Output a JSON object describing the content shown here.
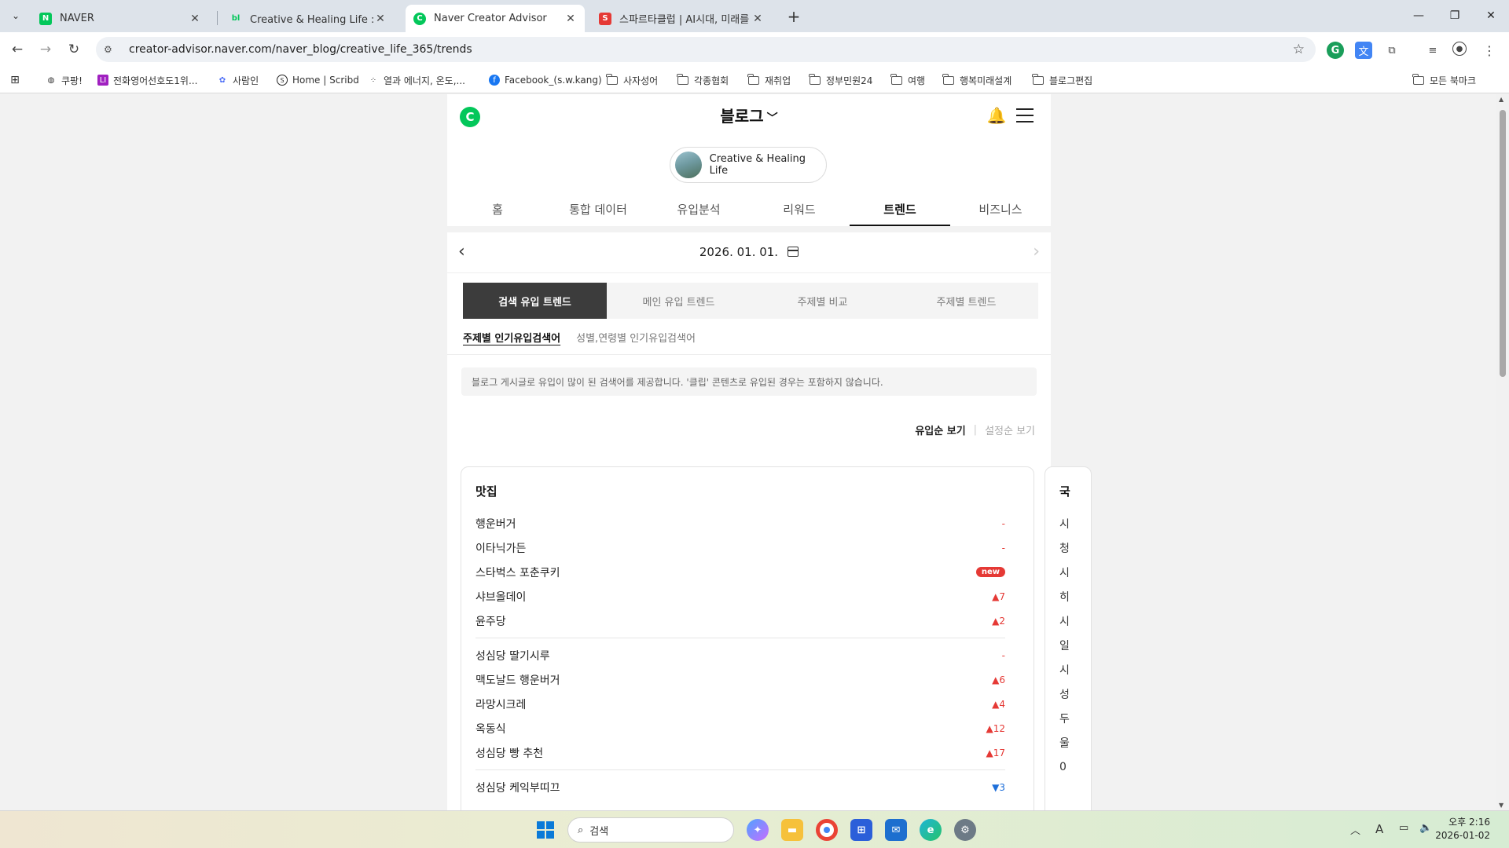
{
  "browser": {
    "tabs": [
      {
        "title": "NAVER",
        "favicon": "N",
        "color": "#03c75a",
        "active": false
      },
      {
        "title": "Creative & Healing Life : 네이버",
        "favicon": "bl",
        "color": "#03c75a",
        "active": false
      },
      {
        "title": "Naver Creator Advisor",
        "favicon": "C",
        "color": "#03c75a",
        "active": true
      },
      {
        "title": "스파르타클럽 | AI시대, 미래를",
        "favicon": "S",
        "color": "#e53935",
        "active": false
      }
    ],
    "url": "creator-advisor.naver.com/naver_blog/creative_life_365/trends",
    "bookmarks": [
      {
        "label": "쿠팡!",
        "type": "site"
      },
      {
        "label": "전화영어선호도1위...",
        "type": "site"
      },
      {
        "label": "사람인",
        "type": "site"
      },
      {
        "label": "Home | Scribd",
        "type": "site"
      },
      {
        "label": "열과 에너지, 온도,...",
        "type": "site"
      },
      {
        "label": "Facebook_(s.w.kang)",
        "type": "site"
      },
      {
        "label": "사자성어",
        "type": "folder"
      },
      {
        "label": "각종협회",
        "type": "folder"
      },
      {
        "label": "재취업",
        "type": "folder"
      },
      {
        "label": "정부민원24",
        "type": "folder"
      },
      {
        "label": "여행",
        "type": "folder"
      },
      {
        "label": "행복미래설계",
        "type": "folder"
      },
      {
        "label": "블로그편집",
        "type": "folder"
      }
    ],
    "all_bookmarks": "모든 북마크"
  },
  "app": {
    "service": "블로그",
    "blog_name": "Creative & Healing Life",
    "main_tabs": [
      "홈",
      "통합 데이터",
      "유입분석",
      "리워드",
      "트렌드",
      "비즈니스"
    ],
    "active_tab": "트렌드",
    "date": "2026. 01. 01.",
    "segments": [
      "검색 유입 트렌드",
      "메인 유입 트렌드",
      "주제별 비교",
      "주제별 트렌드"
    ],
    "subtabs": [
      "주제별 인기유입검색어",
      "성별,연령별 인기유입검색어"
    ],
    "notice": "블로그 게시글로 유입이 많이 된 검색어를 제공합니다. '클립' 콘텐츠로 유입된 경우는 포함하지 않습니다.",
    "sort": {
      "active": "유입순 보기",
      "inactive": "설정순 보기"
    },
    "card": {
      "title": "맛집",
      "groups": [
        [
          {
            "term": "행운버거",
            "change": "-",
            "kind": "none"
          },
          {
            "term": "이타닉가든",
            "change": "-",
            "kind": "none"
          },
          {
            "term": "스타벅스 포춘쿠키",
            "change": "new",
            "kind": "new"
          },
          {
            "term": "샤브올데이",
            "change": "▲7",
            "kind": "up"
          },
          {
            "term": "윤주당",
            "change": "▲2",
            "kind": "up"
          }
        ],
        [
          {
            "term": "성심당 딸기시루",
            "change": "-",
            "kind": "none"
          },
          {
            "term": "맥도날드 행운버거",
            "change": "▲6",
            "kind": "up"
          },
          {
            "term": "라망시크레",
            "change": "▲4",
            "kind": "up"
          },
          {
            "term": "옥동식",
            "change": "▲12",
            "kind": "up"
          },
          {
            "term": "성심당 빵 추천",
            "change": "▲17",
            "kind": "up"
          }
        ],
        [
          {
            "term": "성심당 케익부띠끄",
            "change": "▼3",
            "kind": "down"
          }
        ]
      ]
    },
    "card2": {
      "title": "국",
      "rows": [
        "시",
        "청",
        "시",
        "히",
        "시",
        "일",
        "시",
        "성",
        "두",
        "울",
        "0"
      ]
    }
  },
  "taskbar": {
    "search_placeholder": "검색",
    "time": "오후 2:16",
    "date": "2026-01-02"
  }
}
